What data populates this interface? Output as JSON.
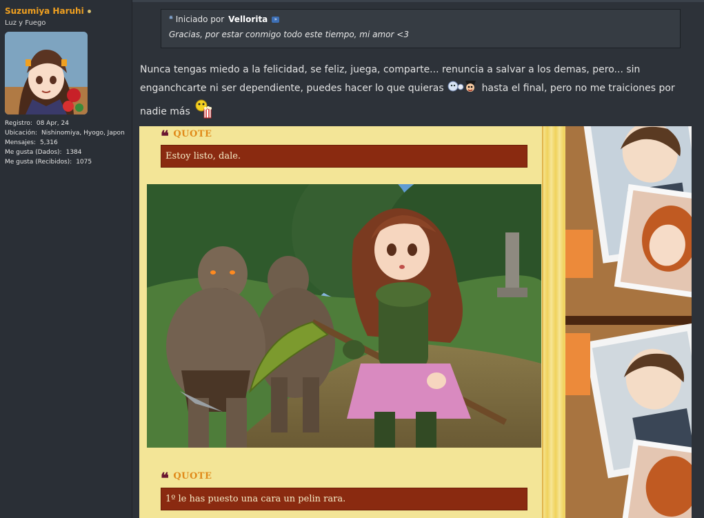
{
  "user": {
    "name": "Suzumiya Haruhi",
    "title": "Luz y Fuego",
    "stats": [
      {
        "label": "Registro:",
        "value": "08 Apr, 24"
      },
      {
        "label": "Ubicación:",
        "value": "Nishinomiya, Hyogo, Japon"
      },
      {
        "label": "Mensajes:",
        "value": "5,316"
      },
      {
        "label": "Me gusta (Dados):",
        "value": "1384"
      },
      {
        "label": "Me gusta (Recibidos):",
        "value": "1075"
      }
    ]
  },
  "quoted_post": {
    "prefix": "Iniciado por",
    "author": "Vellorita",
    "text": "Gracias, por estar conmigo todo este tiempo, mi amor <3"
  },
  "post": {
    "text_part1": "Nunca tengas miedo a la felicidad, se feliz, juega, comparte... renuncia a salvar a los demas, pero... sin enganchcarte ni ser dependiente, puedes hacer lo que quieras",
    "text_part2": "hasta el final, pero no me traiciones por nadie más"
  },
  "signature": {
    "quote1": {
      "label": "QUOTE",
      "text": "Estoy listo, dale."
    },
    "quote2": {
      "label": "QUOTE",
      "text": "1º le has puesto una cara un pelin rara."
    }
  },
  "colors": {
    "username": "#f0a020",
    "quote_bar": "#8a2a10",
    "signature_bg": "#f3e597"
  }
}
